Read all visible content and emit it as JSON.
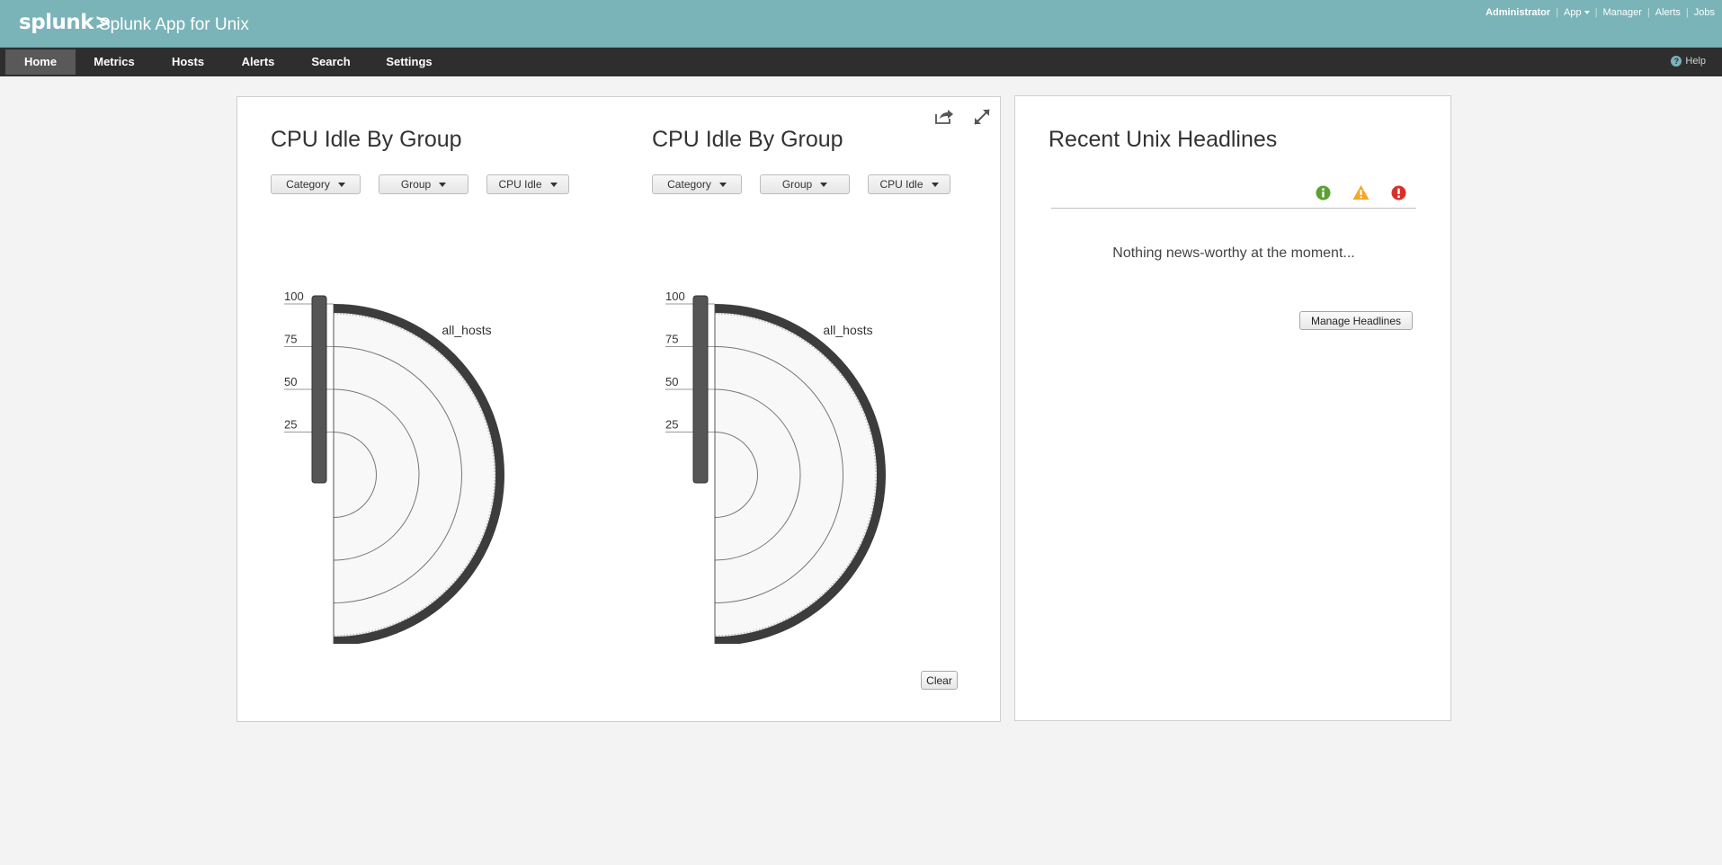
{
  "header": {
    "logo_text": "splunk",
    "logo_chevron": ">",
    "app_title": "Splunk App for Unix",
    "links": {
      "user": "Administrator",
      "app": "App",
      "manager": "Manager",
      "alerts": "Alerts",
      "jobs": "Jobs"
    },
    "separator": "|"
  },
  "nav": {
    "items": [
      {
        "label": "Home",
        "active": true
      },
      {
        "label": "Metrics"
      },
      {
        "label": "Hosts"
      },
      {
        "label": "Alerts"
      },
      {
        "label": "Search"
      },
      {
        "label": "Settings"
      }
    ],
    "help": "Help"
  },
  "charts": [
    {
      "title": "CPU Idle By Group",
      "dropdowns": {
        "category": "Category",
        "group": "Group",
        "metric": "CPU Idle"
      },
      "series_label": "all_hosts"
    },
    {
      "title": "CPU Idle By Group",
      "dropdowns": {
        "category": "Category",
        "group": "Group",
        "metric": "CPU Idle"
      },
      "series_label": "all_hosts"
    }
  ],
  "clear_button": "Clear",
  "headlines": {
    "title": "Recent Unix Headlines",
    "empty_message": "Nothing news-worthy at the moment...",
    "manage_button": "Manage Headlines",
    "severity_icons": [
      "info-icon",
      "warning-icon",
      "error-icon"
    ]
  },
  "chart_data": [
    {
      "type": "polar",
      "title": "CPU Idle By Group",
      "series": [
        {
          "name": "all_hosts",
          "values": [
            100
          ]
        }
      ],
      "axis_ticks": [
        100,
        75,
        50,
        25
      ],
      "ylim": [
        0,
        100
      ]
    },
    {
      "type": "polar",
      "title": "CPU Idle By Group",
      "series": [
        {
          "name": "all_hosts",
          "values": [
            100
          ]
        }
      ],
      "axis_ticks": [
        100,
        75,
        50,
        25
      ],
      "ylim": [
        0,
        100
      ]
    }
  ],
  "colors": {
    "topbar": "#7ab3b8",
    "navbar": "#2e2e2e",
    "nav_active": "#595959",
    "gauge_ring": "#3c3c3c",
    "info": "#5aa032",
    "warning": "#f5a623",
    "error": "#d9302c"
  }
}
